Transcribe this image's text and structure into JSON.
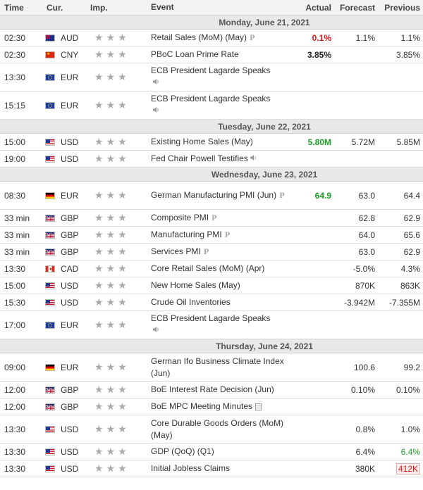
{
  "header": {
    "time": "Time",
    "cur": "Cur.",
    "imp": "Imp.",
    "event": "Event",
    "actual": "Actual",
    "forecast": "Forecast",
    "previous": "Previous"
  },
  "days": [
    {
      "label": "Monday, June 21, 2021",
      "rows": [
        {
          "time": "02:30",
          "flag": "au",
          "cur": "AUD",
          "event": "Retail Sales (MoM) (May)",
          "icon": "preliminary-icon",
          "actual": "0.1%",
          "actual_color": "red",
          "forecast": "1.1%",
          "previous": "1.1%",
          "h": 24
        },
        {
          "time": "02:30",
          "flag": "cn",
          "cur": "CNY",
          "event": "PBoC Loan Prime Rate",
          "icon": "",
          "actual": "3.85%",
          "actual_color": "black",
          "forecast": "",
          "previous": "3.85%",
          "h": 24
        },
        {
          "time": "13:30",
          "flag": "eu",
          "cur": "EUR",
          "event": "ECB President Lagarde Speaks",
          "icon": "speaker-icon",
          "actual": "",
          "forecast": "",
          "previous": "",
          "h": 40
        },
        {
          "time": "15:15",
          "flag": "eu",
          "cur": "EUR",
          "event": "ECB President Lagarde Speaks",
          "icon": "speaker-icon",
          "actual": "",
          "forecast": "",
          "previous": "",
          "h": 40
        }
      ]
    },
    {
      "label": "Tuesday, June 22, 2021",
      "rows": [
        {
          "time": "15:00",
          "flag": "us",
          "cur": "USD",
          "event": "Existing Home Sales (May)",
          "icon": "",
          "actual": "5.80M",
          "actual_color": "green",
          "forecast": "5.72M",
          "previous": "5.85M",
          "h": 24
        },
        {
          "time": "19:00",
          "flag": "us",
          "cur": "USD",
          "event": "Fed Chair Powell Testifies",
          "icon": "speaker-icon",
          "actual": "",
          "forecast": "",
          "previous": "",
          "h": 24
        }
      ]
    },
    {
      "label": "Wednesday, June 23, 2021",
      "rows": [
        {
          "time": "08:30",
          "flag": "de",
          "cur": "EUR",
          "event": "German Manufacturing PMI (Jun)",
          "icon": "preliminary-icon",
          "actual": "64.9",
          "actual_color": "green",
          "forecast": "63.0",
          "previous": "64.4",
          "h": 40
        },
        {
          "time": "33 min",
          "flag": "gb",
          "cur": "GBP",
          "event": "Composite PMI",
          "icon": "preliminary-icon",
          "actual": "",
          "forecast": "62.8",
          "previous": "62.9",
          "h": 24
        },
        {
          "time": "33 min",
          "flag": "gb",
          "cur": "GBP",
          "event": "Manufacturing PMI",
          "icon": "preliminary-icon",
          "actual": "",
          "forecast": "64.0",
          "previous": "65.6",
          "h": 24
        },
        {
          "time": "33 min",
          "flag": "gb",
          "cur": "GBP",
          "event": "Services PMI",
          "icon": "preliminary-icon",
          "actual": "",
          "forecast": "63.0",
          "previous": "62.9",
          "h": 24
        },
        {
          "time": "13:30",
          "flag": "ca",
          "cur": "CAD",
          "event": "Core Retail Sales (MoM) (Apr)",
          "icon": "",
          "actual": "",
          "forecast": "-5.0%",
          "previous": "4.3%",
          "h": 24
        },
        {
          "time": "15:00",
          "flag": "us",
          "cur": "USD",
          "event": "New Home Sales (May)",
          "icon": "",
          "actual": "",
          "forecast": "870K",
          "previous": "863K",
          "h": 24
        },
        {
          "time": "15:30",
          "flag": "us",
          "cur": "USD",
          "event": "Crude Oil Inventories",
          "icon": "",
          "actual": "",
          "forecast": "-3.942M",
          "previous": "-7.355M",
          "h": 24
        },
        {
          "time": "17:00",
          "flag": "eu",
          "cur": "EUR",
          "event": "ECB President Lagarde Speaks",
          "icon": "speaker-icon",
          "actual": "",
          "forecast": "",
          "previous": "",
          "h": 40
        }
      ]
    },
    {
      "label": "Thursday, June 24, 2021",
      "rows": [
        {
          "time": "09:00",
          "flag": "de",
          "cur": "EUR",
          "event": "German Ifo Business Climate Index (Jun)",
          "icon": "",
          "actual": "",
          "forecast": "100.6",
          "previous": "99.2",
          "h": 40
        },
        {
          "time": "12:00",
          "flag": "gb",
          "cur": "GBP",
          "event": "BoE Interest Rate Decision (Jun)",
          "icon": "",
          "actual": "",
          "forecast": "0.10%",
          "previous": "0.10%",
          "h": 24
        },
        {
          "time": "12:00",
          "flag": "gb",
          "cur": "GBP",
          "event": "BoE MPC Meeting Minutes",
          "icon": "document-icon",
          "actual": "",
          "forecast": "",
          "previous": "",
          "h": 24
        },
        {
          "time": "13:30",
          "flag": "us",
          "cur": "USD",
          "event": "Core Durable Goods Orders (MoM) (May)",
          "icon": "",
          "actual": "",
          "forecast": "0.8%",
          "previous": "1.0%",
          "h": 40
        },
        {
          "time": "13:30",
          "flag": "us",
          "cur": "USD",
          "event": "GDP (QoQ) (Q1)",
          "icon": "",
          "actual": "",
          "forecast": "6.4%",
          "previous": "6.4%",
          "previous_color": "green",
          "h": 24
        },
        {
          "time": "13:30",
          "flag": "us",
          "cur": "USD",
          "event": "Initial Jobless Claims",
          "icon": "",
          "actual": "",
          "forecast": "380K",
          "previous": "412K",
          "previous_color": "red",
          "h": 24
        }
      ]
    }
  ]
}
